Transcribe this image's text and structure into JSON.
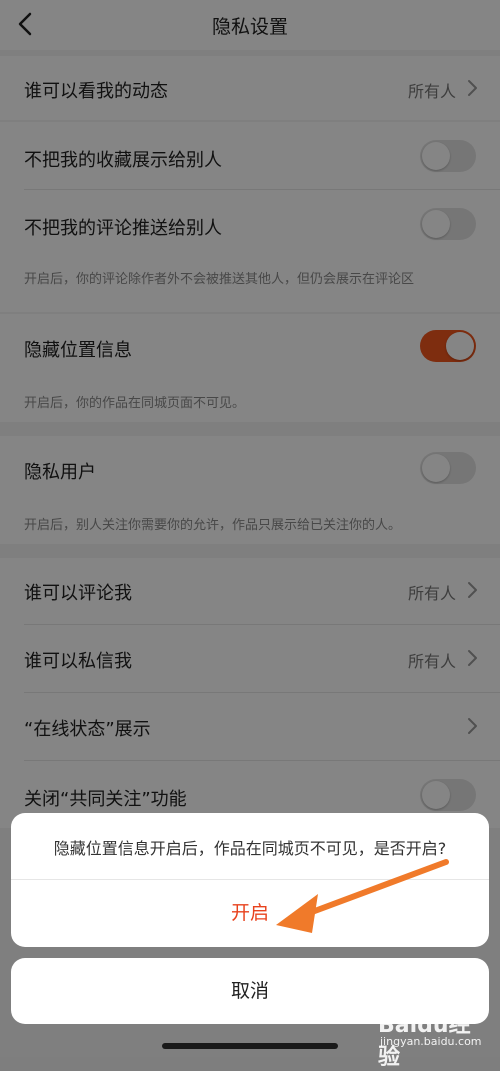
{
  "header": {
    "title": "隐私设置"
  },
  "rows": {
    "dynamic": {
      "label": "谁可以看我的动态",
      "value": "所有人"
    },
    "favorites": {
      "label": "不把我的收藏展示给别人",
      "toggle": false
    },
    "comments_push": {
      "label": "不把我的评论推送给别人",
      "toggle": false,
      "hint": "开启后，你的评论除作者外不会被推送其他人，但仍会展示在评论区"
    },
    "hide_location": {
      "label": "隐藏位置信息",
      "toggle": true,
      "hint": "开启后，你的作品在同城页面不可见。"
    },
    "private_user": {
      "label": "隐私用户",
      "toggle": false,
      "hint": "开启后，别人关注你需要你的允许，作品只展示给已关注你的人。"
    },
    "who_comment": {
      "label": "谁可以评论我",
      "value": "所有人"
    },
    "who_message": {
      "label": "谁可以私信我",
      "value": "所有人"
    },
    "online_status": {
      "label": "“在线状态”展示"
    },
    "mutual_follow": {
      "label": "关闭“共同关注”功能",
      "toggle": false
    }
  },
  "dialog": {
    "message": "隐藏位置信息开启后，作品在同城页不可见，是否开启?",
    "confirm_label": "开启",
    "cancel_label": "取消",
    "accent_color": "#e8421d"
  },
  "annotation": {
    "arrow_color": "#f07a2a"
  },
  "watermark": {
    "text": "Baidu经验",
    "sub": "jingyan.baidu.com"
  },
  "colors": {
    "toggle_on": "#f2561d",
    "background": "#f3f3f3"
  }
}
